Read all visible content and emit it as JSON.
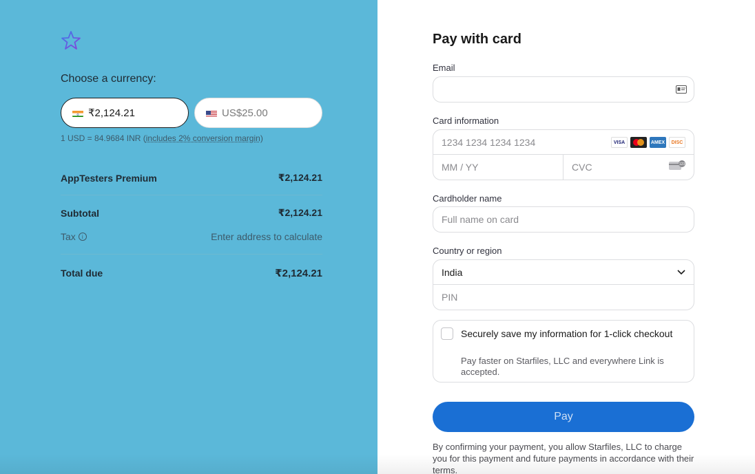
{
  "summary": {
    "choose_label": "Choose a currency:",
    "currency_selected": "₹2,124.21",
    "currency_other": "US$25.00",
    "rate_prefix": "1 USD = 84.9684 INR (",
    "rate_link": "includes 2% conversion margin",
    "rate_suffix": ")",
    "product_name": "AppTesters Premium",
    "product_price": "₹2,124.21",
    "subtotal_label": "Subtotal",
    "subtotal_value": "₹2,124.21",
    "tax_label": "Tax",
    "tax_value": "Enter address to calculate",
    "total_label": "Total due",
    "total_value": "₹2,124.21"
  },
  "form": {
    "title": "Pay with card",
    "email_label": "Email",
    "email_value": "",
    "card_label": "Card information",
    "card_number_placeholder": "1234 1234 1234 1234",
    "expiry_placeholder": "MM / YY",
    "cvc_placeholder": "CVC",
    "card_brands": [
      "VISA",
      "MC",
      "AMEX",
      "DISC"
    ],
    "cardholder_label": "Cardholder name",
    "cardholder_placeholder": "Full name on card",
    "country_label": "Country or region",
    "country_value": "India",
    "pin_placeholder": "PIN",
    "save_title": "Securely save my information for 1-click checkout",
    "save_subtitle": "Pay faster on Starfiles, LLC and everywhere Link is accepted.",
    "pay_label": "Pay",
    "legal_text": "By confirming your payment, you allow Starfiles, LLC to charge you for this payment and future payments in accordance with their terms."
  },
  "colors": {
    "left_bg": "#5bb8d9",
    "pay_button": "#1a6fd4"
  }
}
